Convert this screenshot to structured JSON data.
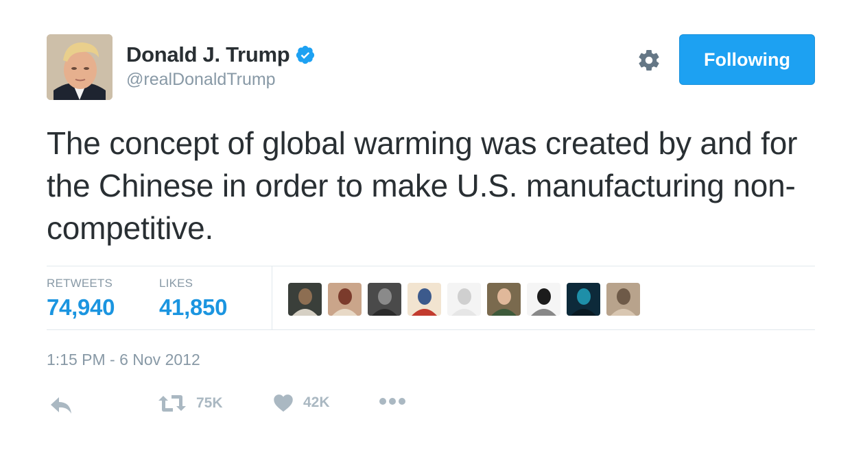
{
  "author": {
    "name": "Donald J. Trump",
    "handle": "@realDonaldTrump",
    "verified": true
  },
  "header": {
    "settings_icon": "gear-icon",
    "follow_button_label": "Following"
  },
  "tweet": {
    "text": "The concept of global warming was created by and for the Chinese in order to make U.S. manufacturing non-competitive.",
    "timestamp": "1:15 PM - 6 Nov 2012"
  },
  "stats": {
    "retweets_label": "RETWEETS",
    "retweets_value": "74,940",
    "likes_label": "LIKES",
    "likes_value": "41,850"
  },
  "likers": [
    {
      "name": "liker-1",
      "colors": [
        "#3a3f3a",
        "#8d6e52",
        "#d6d0c4"
      ]
    },
    {
      "name": "liker-2",
      "colors": [
        "#caa58a",
        "#7b3b2c",
        "#e8d9c6"
      ]
    },
    {
      "name": "liker-3",
      "colors": [
        "#4a4a4a",
        "#8a8a8a",
        "#2b2b2b"
      ]
    },
    {
      "name": "liker-4",
      "colors": [
        "#f2e4d0",
        "#3c5a8c",
        "#c23b2e"
      ]
    },
    {
      "name": "liker-5",
      "colors": [
        "#f4f4f4",
        "#cfcfcf",
        "#e6e6e6"
      ]
    },
    {
      "name": "liker-6",
      "colors": [
        "#7a6a4e",
        "#e0b89a",
        "#3d5a3a"
      ]
    },
    {
      "name": "liker-7",
      "colors": [
        "#f5f5f5",
        "#1c1c1c",
        "#888888"
      ]
    },
    {
      "name": "liker-8",
      "colors": [
        "#0d2a3a",
        "#1e8fa8",
        "#0a1a22"
      ]
    },
    {
      "name": "liker-9",
      "colors": [
        "#b8a38c",
        "#6e5a48",
        "#d9c7b2"
      ]
    }
  ],
  "actions": {
    "reply_icon": "reply-icon",
    "retweet_count": "75K",
    "like_count": "42K",
    "more_icon": "more-icon"
  },
  "colors": {
    "accent": "#1da1f2",
    "stat_value": "#1b95e0",
    "muted": "#8899a6",
    "action": "#aab8c2",
    "text": "#292f33"
  }
}
